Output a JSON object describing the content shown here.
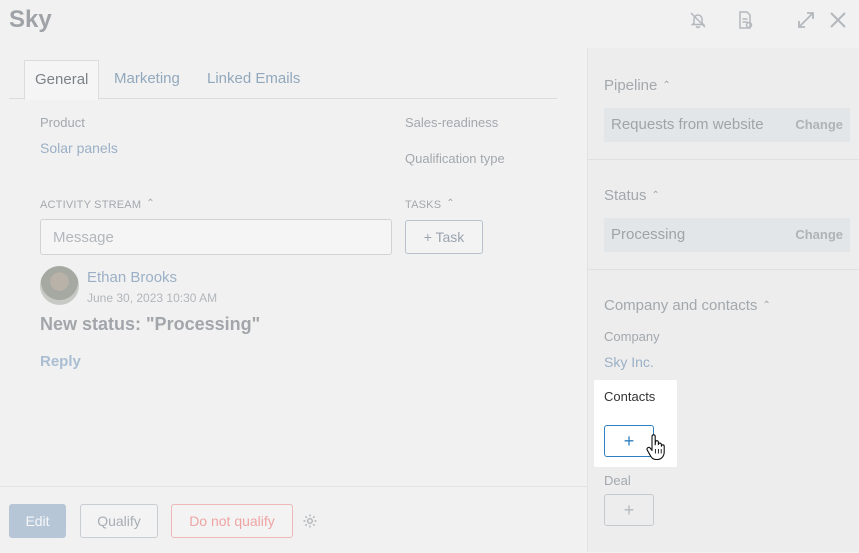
{
  "header": {
    "title": "Sky",
    "icons": [
      "bell-off-icon",
      "document-icon",
      "expand-icon",
      "close-icon"
    ]
  },
  "tabs": [
    {
      "label": "General",
      "active": true
    },
    {
      "label": "Marketing",
      "active": false
    },
    {
      "label": "Linked Emails",
      "active": false
    }
  ],
  "fields": {
    "product_label": "Product",
    "product_value": "Solar panels",
    "sales_readiness_label": "Sales-readiness",
    "qualification_type_label": "Qualification type"
  },
  "activity": {
    "section_label": "ACTIVITY STREAM",
    "message_placeholder": "Message",
    "author": "Ethan Brooks",
    "date": "June 30, 2023 10:30 AM",
    "text": "New status: \"Processing\"",
    "reply_label": "Reply"
  },
  "tasks": {
    "section_label": "TASKS",
    "task_button": "+ Task"
  },
  "footer": {
    "edit": "Edit",
    "qualify": "Qualify",
    "do_not_qualify": "Do not qualify"
  },
  "sidebar": {
    "pipeline": {
      "title": "Pipeline",
      "value": "Requests from website",
      "change": "Change"
    },
    "status": {
      "title": "Status",
      "value": "Processing",
      "change": "Change"
    },
    "company_contacts": {
      "title": "Company and contacts",
      "company_label": "Company",
      "company_value": "Sky Inc.",
      "contacts_label": "Contacts",
      "add_symbol": "+",
      "deal_label": "Deal"
    }
  },
  "colors": {
    "accent": "#2f7fc1",
    "danger": "#efa4a4",
    "highlight_bg": "#ffffff"
  }
}
